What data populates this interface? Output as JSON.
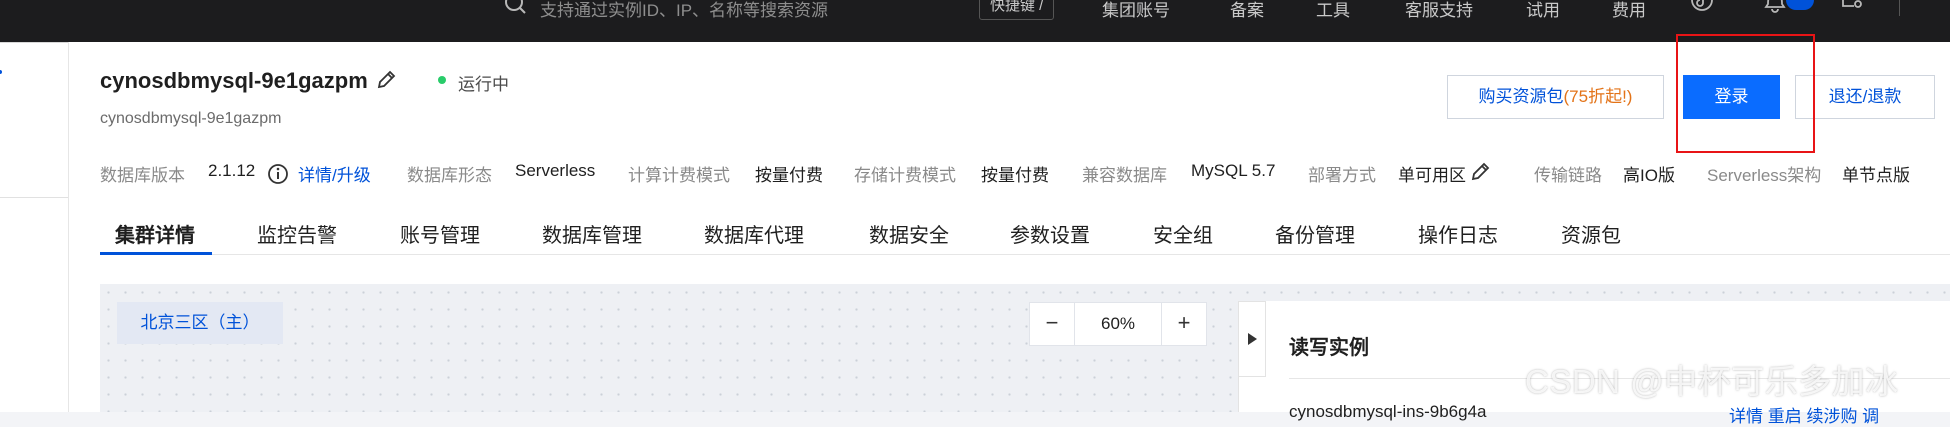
{
  "topbar": {
    "search_placeholder": "支持通过实例ID、IP、名称等搜索资源",
    "shortcut": "快捷键 /",
    "links": [
      "集团账号",
      "备案",
      "工具",
      "客服支持",
      "试用",
      "费用"
    ]
  },
  "instance": {
    "name": "cynosdbmysql-9e1gazpm",
    "id": "cynosdbmysql-9e1gazpm",
    "status": "运行中",
    "status_color": "#29cc6a"
  },
  "actions": {
    "buy_label": "购买资源包",
    "buy_discount": "(75折起!)",
    "login_label": "登录",
    "renew_label": "退还/退款"
  },
  "meta": {
    "db_version_label": "数据库版本",
    "db_version_value": "2.1.12",
    "db_version_link": "详情/升级",
    "db_form_label": "数据库形态",
    "db_form_value": "Serverless",
    "compute_billing_label": "计算计费模式",
    "compute_billing_value": "按量付费",
    "storage_billing_label": "存储计费模式",
    "storage_billing_value": "按量付费",
    "compat_label": "兼容数据库",
    "compat_value": "MySQL 5.7",
    "deploy_label": "部署方式",
    "deploy_value": "单可用区",
    "link_label": "传输链路",
    "link_value": "高IO版",
    "arch_label": "Serverless架构",
    "arch_value": "单节点版"
  },
  "tabs": [
    "集群详情",
    "监控告警",
    "账号管理",
    "数据库管理",
    "数据库代理",
    "数据安全",
    "参数设置",
    "安全组",
    "备份管理",
    "操作日志",
    "资源包"
  ],
  "active_tab": "集群详情",
  "canvas": {
    "region": "北京三区（主）",
    "zoom": "60%",
    "zoom_minus": "−",
    "zoom_plus": "+"
  },
  "side_panel": {
    "title": "读写实例",
    "row_text": "cynosdbmysql-ins-9b6g4a",
    "row_links": "详情 重启 续涉购 调"
  },
  "watermark": "CSDN @中杯可乐多加冰",
  "colors": {
    "accent": "#0052d9",
    "primary_button": "#0a6cff",
    "discount": "#e37318",
    "highlight": "#e81416"
  }
}
